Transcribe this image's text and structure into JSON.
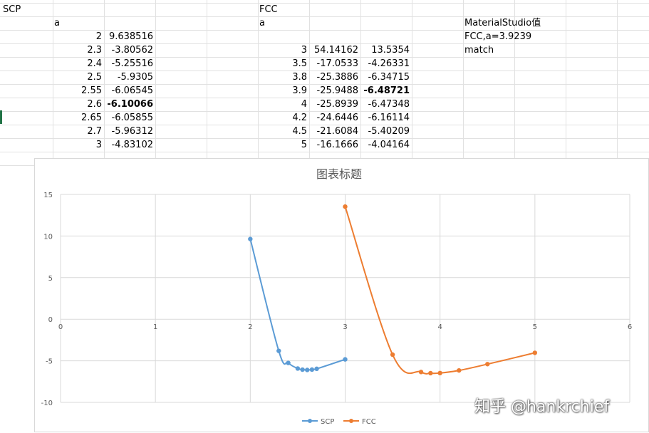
{
  "sheet": {
    "scp_header": "SCP",
    "scp_a_label": "a",
    "scp_rows": [
      [
        "2",
        "9.638516"
      ],
      [
        "2.3",
        "-3.80562"
      ],
      [
        "2.4",
        "-5.25516"
      ],
      [
        "2.5",
        "-5.9305"
      ],
      [
        "2.55",
        "-6.06545"
      ],
      [
        "2.6",
        "-6.10066"
      ],
      [
        "2.65",
        "-6.05855"
      ],
      [
        "2.7",
        "-5.96312"
      ],
      [
        "3",
        "-4.83102"
      ]
    ],
    "fcc_header": "FCC",
    "fcc_a_label": "a",
    "fcc_rows": [
      [
        "3",
        "54.14162",
        "13.5354"
      ],
      [
        "3.5",
        "-17.0533",
        "-4.26331"
      ],
      [
        "3.8",
        "-25.3886",
        "-6.34715"
      ],
      [
        "3.9",
        "-25.9488",
        "-6.48721"
      ],
      [
        "4",
        "-25.8939",
        "-6.47348"
      ],
      [
        "4.2",
        "-24.6446",
        "-6.16114"
      ],
      [
        "4.5",
        "-21.6084",
        "-5.40209"
      ],
      [
        "5",
        "-16.1666",
        "-4.04164"
      ]
    ],
    "notes": [
      "MaterialStudio值",
      "FCC,a=3.9239",
      "match"
    ]
  },
  "chart_data": {
    "type": "line",
    "title": "图表标题",
    "xlim": [
      0,
      6
    ],
    "ylim": [
      -10,
      15
    ],
    "x_ticks": [
      0,
      1,
      2,
      3,
      4,
      5,
      6
    ],
    "y_ticks": [
      15,
      10,
      5,
      0,
      -5,
      -10
    ],
    "grid": true,
    "legend": "bottom",
    "series": [
      {
        "name": "SCP",
        "color": "#5b9bd5",
        "x": [
          2,
          2.3,
          2.4,
          2.5,
          2.55,
          2.6,
          2.65,
          2.7,
          3
        ],
        "y": [
          9.638516,
          -3.80562,
          -5.25516,
          -5.9305,
          -6.06545,
          -6.10066,
          -6.05855,
          -5.96312,
          -4.83102
        ]
      },
      {
        "name": "FCC",
        "color": "#ed7d31",
        "x": [
          3,
          3.5,
          3.8,
          3.9,
          4,
          4.2,
          4.5,
          5
        ],
        "y": [
          13.5354,
          -4.26331,
          -6.34715,
          -6.48721,
          -6.47348,
          -6.16114,
          -5.40209,
          -4.04164
        ]
      }
    ]
  },
  "watermark": "知乎 @hankrchief"
}
